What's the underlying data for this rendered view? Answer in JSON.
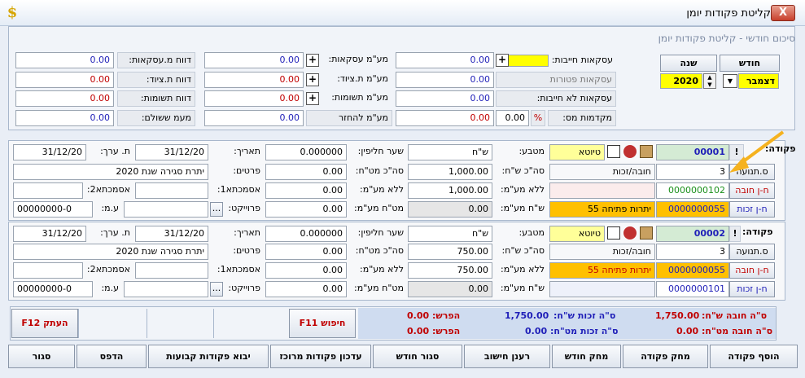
{
  "window": {
    "title": "קליטת פקודות יומן",
    "close_label": "X",
    "app_icon": "dollar-icon"
  },
  "summary": {
    "heading": "סיכום חודשי - קליטת פקודות יומן",
    "month_btn": "חודש",
    "year_btn": "שנה",
    "month_value": "דצמבר",
    "year_value": "2020",
    "rows": [
      {
        "label_a": "עסקאות חייבות:",
        "val_a": "0.00",
        "label_b": "מע\"מ עסקאות:",
        "val_b": "0.00",
        "label_c": "דווח מ.עסקאות:",
        "val_c": "0.00"
      },
      {
        "label_a": "עסקאות פטורות",
        "val_a": "0.00",
        "label_b": "מע\"מ ת.ציוד:",
        "val_b": "0.00",
        "label_c": "דווח ת.ציוד:",
        "val_c": "0.00"
      },
      {
        "label_a": "עסקאות לא חייבות:",
        "val_a": "0.00",
        "label_b": "מע\"מ תשומות:",
        "val_b": "0.00",
        "label_c": "דווח תשומות:",
        "val_c": "0.00"
      }
    ],
    "advance_label": "מקדמות מס:",
    "advance_value": "0.00",
    "pct": "%",
    "vat_refund_label": "מע\"מ להחזר",
    "vat_refund_value": "0.00",
    "vat_paid_label": "מעמ ששולם:",
    "vat_paid_value": "0.00"
  },
  "records": [
    {
      "pkuda_label": "פקודה:",
      "pkuda_no": "00001",
      "excl": "!",
      "status": "טיוטא",
      "tnua_btn": "ס.תנועה",
      "tnua_val": "3",
      "tnua_type": "חובה/זכות",
      "debit_btn": "ח-ן חובה",
      "debit_acc": "0000000102",
      "debit_name": "",
      "credit_btn": "ח-ן זכות",
      "credit_acc": "0000000055",
      "credit_name": "יתרות פתיחה  55",
      "currency_label": "מטבע:",
      "currency": "ש\"ח",
      "total_nis_label": "סה\"כ ש\"ח:",
      "total_nis": "1,000.00",
      "novat_label": "ללא מע\"מ:",
      "novat": "1,000.00",
      "vat_nis_label": "ש\"ח מע\"מ:",
      "vat_nis": "0.00",
      "rate_label": "שער חליפין:",
      "rate": "0.000000",
      "total_fx_label": "סה\"כ מט\"ח:",
      "total_fx": "0.00",
      "novat_fx_label": "ללא מע\"מ:",
      "novat_fx": "0.00",
      "vat_fx_label": "מט\"ח מע\"מ:",
      "vat_fx": "0.00",
      "date_label": "תאריך:",
      "date": "31/12/20",
      "value_date_label": "ת. ערך:",
      "value_date": "31/12/20",
      "details_label": "פרטים:",
      "details": "יתרת סגירה שנת 2020",
      "ref1_label": "אסמכתא1:",
      "ref1": "",
      "ref2_label": "אסמכתא2:",
      "ref2": "",
      "project_label": "פרוייקט:",
      "project": "",
      "project_btn": "...",
      "vm_label": "ע.מ:",
      "vm": "00000000-0"
    },
    {
      "pkuda_label": "פקודה:",
      "pkuda_no": "00002",
      "excl": "!",
      "status": "טיוטא",
      "tnua_btn": "ס.תנועה",
      "tnua_val": "3",
      "tnua_type": "חובה/זכות",
      "debit_btn": "ח-ן חובה",
      "debit_acc": "0000000055",
      "debit_name": "יתרות פתיחה  55",
      "credit_btn": "ח-ן זכות",
      "credit_acc": "0000000101",
      "credit_name": "",
      "currency_label": "מטבע:",
      "currency": "ש\"ח",
      "total_nis_label": "סה\"כ ש\"ח:",
      "total_nis": "750.00",
      "novat_label": "ללא מע\"מ:",
      "novat": "750.00",
      "vat_nis_label": "ש\"ח מע\"מ:",
      "vat_nis": "0.00",
      "rate_label": "שער חליפין:",
      "rate": "0.000000",
      "total_fx_label": "סה\"כ מט\"ח:",
      "total_fx": "0.00",
      "novat_fx_label": "ללא מע\"מ:",
      "novat_fx": "0.00",
      "vat_fx_label": "מט\"ח מע\"מ:",
      "vat_fx": "0.00",
      "date_label": "תאריך:",
      "date": "31/12/20",
      "value_date_label": "ת. ערך:",
      "value_date": "31/12/20",
      "details_label": "פרטים:",
      "details": "יתרת סגירה שנת 2020",
      "ref1_label": "אסמכתא1:",
      "ref1": "",
      "ref2_label": "אסמכתא2:",
      "ref2": "",
      "project_label": "פרוייקט:",
      "project": "",
      "project_btn": "...",
      "vm_label": "ע.מ:",
      "vm": "00000000-0"
    }
  ],
  "totals": {
    "debit_nis_label": "ס\"ה חובה ש\"ח:",
    "debit_nis": "1,750.00",
    "credit_nis_label": "ס\"ה זכות ש\"ח:",
    "credit_nis": "1,750.00",
    "diff_label": "הפרש:",
    "diff_nis": "0.00",
    "debit_fx_label": "ס\"ה חובה מט\"ח:",
    "debit_fx": "0.00",
    "credit_fx_label": "ס\"ה זכות מט\"ח:",
    "credit_fx": "0.00",
    "diff_fx": "0.00",
    "search_btn": "חיפוש F11",
    "copy_btn": "העתק F12"
  },
  "buttons": [
    "הוסף פקודה",
    "מחק פקודה",
    "מחק חודש",
    "רענן חישוב",
    "סגור חודש",
    "עדכון פקודות מרוכז",
    "יבוא פקודות קבועות",
    "הדפס",
    "סגור"
  ]
}
